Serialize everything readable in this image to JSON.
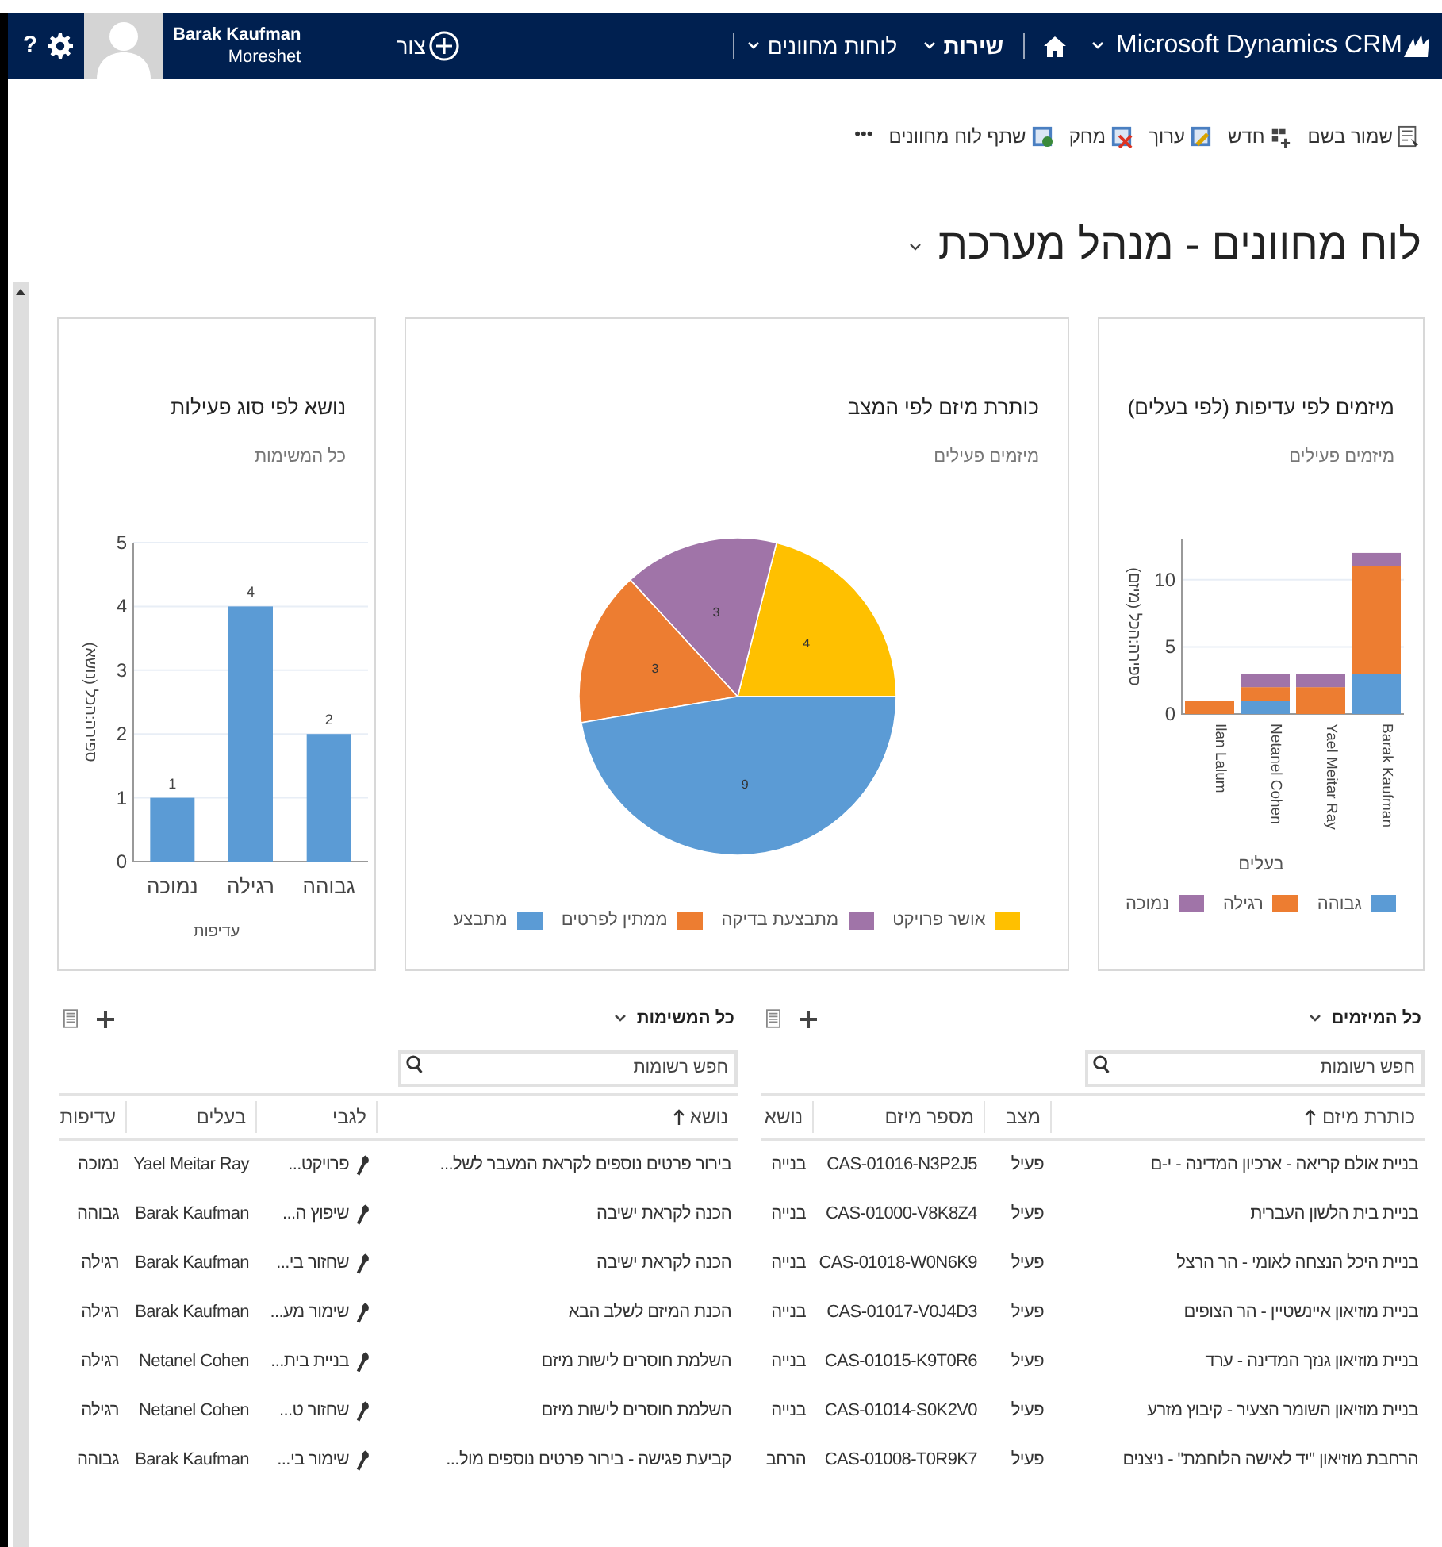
{
  "nav": {
    "help": "?",
    "user": {
      "name": "Barak Kaufman",
      "org": "Moreshet"
    },
    "create": "צור",
    "brand": "Microsoft Dynamics CRM",
    "area": "שירות",
    "section": "לוחות מחוונים"
  },
  "commands": [
    {
      "label": "שמור בשם",
      "kind": "command"
    },
    {
      "label": "חדש",
      "kind": "command"
    },
    {
      "label": "ערוך",
      "kind": "command"
    },
    {
      "label": "מחק",
      "kind": "command"
    },
    {
      "label": "שתף לוח מחוונים",
      "kind": "command"
    },
    {
      "label": "•••",
      "kind": "more"
    }
  ],
  "dashboard_title": "לוח מחוונים - מנהל מערכת",
  "charts": [
    {
      "subtitle": "מיזמים פעילים",
      "chart_data": {
        "type": "bar",
        "title": "מיזמים לפי עדיפות (לפי בעלים)",
        "xlabel": "בעלים",
        "ylabel": "ספירה:הכל (מיזם)",
        "categories": [
          "Ilan Lalum",
          "Netanel Cohen",
          "Yael Meitar Ray",
          "Barak Kaufman"
        ],
        "stacked": true,
        "legend": "bottom",
        "grid": true,
        "ylim": [
          0,
          13
        ],
        "yticks": [
          0,
          5,
          10
        ],
        "series": [
          {
            "name": "גבוהה",
            "color": "#5b9bd5",
            "values": [
              0,
              1,
              0,
              3
            ]
          },
          {
            "name": "רגילה",
            "color": "#ed7d31",
            "values": [
              1,
              1,
              2,
              8
            ]
          },
          {
            "name": "נמוכה",
            "color": "#a074a8",
            "values": [
              0,
              1,
              1,
              1
            ]
          }
        ]
      }
    },
    {
      "subtitle": "מיזמים פעילים",
      "chart_data": {
        "type": "pie",
        "title": "כותרת מיזם לפי המצב",
        "categories": [
          "אושר פרויקט",
          "מתבצעת בדיקה",
          "ממתין לפרטים",
          "מתבצע"
        ],
        "values": [
          4,
          3,
          3,
          9
        ],
        "colors": [
          "#ffc000",
          "#a074a8",
          "#ed7d31",
          "#5b9bd5"
        ],
        "data_labels": true,
        "legend": "bottom"
      }
    },
    {
      "subtitle": "כל המשימות",
      "chart_data": {
        "type": "bar",
        "title": "נושא לפי סוג פעילות",
        "xlabel": "עדיפות",
        "ylabel": "ספירה:הכל (נושא)",
        "categories": [
          "נמוכה",
          "רגילה",
          "גבוהה"
        ],
        "values": [
          1,
          4,
          2
        ],
        "color": "#5b9bd5",
        "grid": true,
        "ylim": [
          0,
          5
        ],
        "yticks": [
          0,
          1,
          2,
          3,
          4,
          5
        ],
        "data_labels": true
      }
    }
  ],
  "lists": [
    {
      "view": "כל המיזמים",
      "search_placeholder": "חפש רשומות",
      "columns": [
        {
          "label": "כותרת מיזם",
          "sorted": true,
          "kind": "text"
        },
        {
          "label": "מצב",
          "sorted": false,
          "kind": "text"
        },
        {
          "label": "מספר מיזם",
          "sorted": false,
          "kind": "text"
        },
        {
          "label": "נושא",
          "sorted": false,
          "kind": "text"
        }
      ],
      "rows": [
        [
          "בניית אולם קריאה - ארכיון המדינה - י-ם",
          "פעיל",
          "CAS-01016-N3P2J5",
          "בנייה"
        ],
        [
          "בניית בית הלשון העברית",
          "פעיל",
          "CAS-01000-V8K8Z4",
          "בנייה"
        ],
        [
          "בניית היכל הנצחה לאומי - הר הרצל",
          "פעיל",
          "CAS-01018-W0N6K9",
          "בנייה"
        ],
        [
          "בניית מוזיאון איינשטיין - הר הצופים",
          "פעיל",
          "CAS-01017-V0J4D3",
          "בנייה"
        ],
        [
          "בניית מוזיאון גנזך המדינה - ערד",
          "פעיל",
          "CAS-01015-K9T0R6",
          "בנייה"
        ],
        [
          "בניית מוזיאון השומר הצעיר - קיבוץ מזרע",
          "פעיל",
          "CAS-01014-S0K2V0",
          "בנייה"
        ],
        [
          "הרחבת מוזיאון \"יד לאישה הלוחמת\" - ניצנים",
          "פעיל",
          "CAS-01008-T0R9K7",
          "הרחב"
        ]
      ]
    },
    {
      "view": "כל המשימות",
      "search_placeholder": "חפש רשומות",
      "columns": [
        {
          "label": "נושא",
          "sorted": true,
          "kind": "text"
        },
        {
          "label": "לגבי",
          "sorted": false,
          "kind": "regarding"
        },
        {
          "label": "בעלים",
          "sorted": false,
          "kind": "text"
        },
        {
          "label": "עדיפות",
          "sorted": false,
          "kind": "text"
        }
      ],
      "rows": [
        [
          "בירור פרטים נוספים לקראת המעבר לשל...",
          "פרויקט...",
          "Yael Meitar Ray",
          "נמוכה"
        ],
        [
          "הכנה לקראת ישיבה",
          "שיפוץ ה...",
          "Barak Kaufman",
          "גבוהה"
        ],
        [
          "הכנה לקראת ישיבה",
          "שחזור בי...",
          "Barak Kaufman",
          "רגילה"
        ],
        [
          "הכנת המיזם לשלב הבא",
          "שימור מע...",
          "Barak Kaufman",
          "רגילה"
        ],
        [
          "השלמת חוסרים לישות מיזם",
          "בניית בית...",
          "Netanel Cohen",
          "רגילה"
        ],
        [
          "השלמת חוסרים לישות מיזם",
          "שחזור ט...",
          "Netanel Cohen",
          "רגילה"
        ],
        [
          "קביעת פגישה - בירור פרטים נוספים מול...",
          "שימור בי...",
          "Barak Kaufman",
          "גבוהה"
        ]
      ]
    }
  ]
}
